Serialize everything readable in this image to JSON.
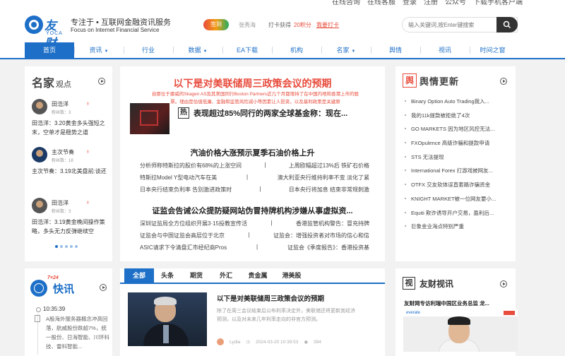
{
  "top_links": {
    "login_register": "在线咨询",
    "online_service": "在线客服",
    "login": "登录",
    "register": "注册",
    "wechat": "公众号",
    "app_download": "下载手机客户端"
  },
  "header": {
    "logo_name": "友财",
    "logo_sub": "YOCA",
    "slogan": "专注于 • 互联网金融资讯服务",
    "slogan_en": "Focus on Internet Financial Service",
    "badge": "签到",
    "user_name": "张秀海",
    "checkin_text": "打卡获得",
    "points": "20积分",
    "checkin_button": "我要打卡",
    "search_placeholder": "输入关键词,按Enter键搜索"
  },
  "nav": {
    "items": [
      "首页",
      "资讯",
      "行业",
      "数据",
      "EA下载",
      "机构",
      "名家",
      "舆情",
      "视讯",
      "时间之窗"
    ]
  },
  "mingjia": {
    "title": "名家",
    "title_suffix": "观点",
    "authors": [
      {
        "name": "田浩洋",
        "fans": "粉丝数：3",
        "quote": "田浩洋：3.20黄金多头强短之末，空单才是稳势之道"
      },
      {
        "name": "主次节奏",
        "fans": "粉丝数：18",
        "quote": "主次节奏：3.19北美盘前:谈还"
      },
      {
        "name": "田浩洋",
        "fans": "粉丝数：3",
        "quote": "田浩洋：3.19黄金晚间操作策略，多头无力反弹继续空"
      }
    ]
  },
  "center_top": {
    "headline": "以下是对美联储周三政策会议的预期",
    "summary": "自那位于挪威的Skagen AS及其美国同行Boston Partners近几个月都增持了在中国内地和香港上市的股票。理由是估值低廉、金融和监管风险减小等因素让人投资，以及基利政策是关键原",
    "hot_tag": "热",
    "hot_title": "表现超过85%同行的两家全球基金称：现在...",
    "section2_title": "汽油价格大涨预示夏季石油价格上升",
    "section2_rows": [
      [
        "分析师称特斯拉的股价有68%的上涨空间",
        "|",
        "上周欧幅超过13%后 铁矿石价格"
      ],
      [
        "特斯拉Model Y型电动汽车在美",
        "|",
        "澳大利亚央行维持利率不变 淡化了紧"
      ],
      [
        "日本央行结束负利率 告别激进政策时",
        "|",
        "日本央行将加息 结束非常规刺激"
      ]
    ],
    "section3_title": "证监会告诫公众提防疑网站伪冒持牌机构涉嫌从事虚拟资...",
    "section3_rows": [
      [
        "深圳证监局全方位组织开展3·15投教宣传活",
        "|",
        "香港监管机构警告：冒充持牌"
      ],
      [
        "证监会与中国证监会高层位于北京",
        "|",
        "证监会：增强投资者对市场的信心和信"
      ],
      [
        "ASIC请求下令清盘汇市经纪商Pros",
        "|",
        "证监会《季度报告》：香港投资基"
      ]
    ]
  },
  "yuqing": {
    "icon": "舆",
    "title": "舆情更新",
    "items": [
      "Binary Option Auto Trading我入...",
      "我的11k提款被拒绝了4次",
      "GO MARKETS 因为地区风控无法...",
      "FXOpulence 高级诈骗和提款申请",
      "STS 无法提现",
      "International Forex 打游戏被网友...",
      "OTFX 交友软体误直套路诈骗资金",
      "KNIGHT MARKET被一位网友要小...",
      "Equiti 欺诈诱导开户交易，盈利后...",
      "巨象金业海点特别严重"
    ]
  },
  "kuaixun": {
    "badge": "7×24",
    "title": "快讯",
    "time": "10:35:39",
    "text": "A股海外服务器概念冲高回落，航威股份跌超7%，统一股份、日海智能、川环科技、雷科智能..."
  },
  "center_bottom": {
    "tabs": [
      "全部",
      "头条",
      "期货",
      "外汇",
      "贵金属",
      "港美股"
    ],
    "article_title": "以下是对美联储周三政策会议的预期",
    "article_summary": "除了在周三会议结束后公布利率决定外，美联储还将更新其经济预测，以及对未来几年利率走向的非官方预测。",
    "author": "Lydia",
    "date": "2024-03-20 10:39:53",
    "views": "394"
  },
  "shixun": {
    "icon": "视",
    "title": "友财视讯",
    "subtitle": "友财网专访利瑞中国区业务总监 龙...",
    "img_logo": "everate"
  },
  "colors": {
    "brand_blue": "#1d6fc7",
    "accent_red": "#e84c3d"
  }
}
